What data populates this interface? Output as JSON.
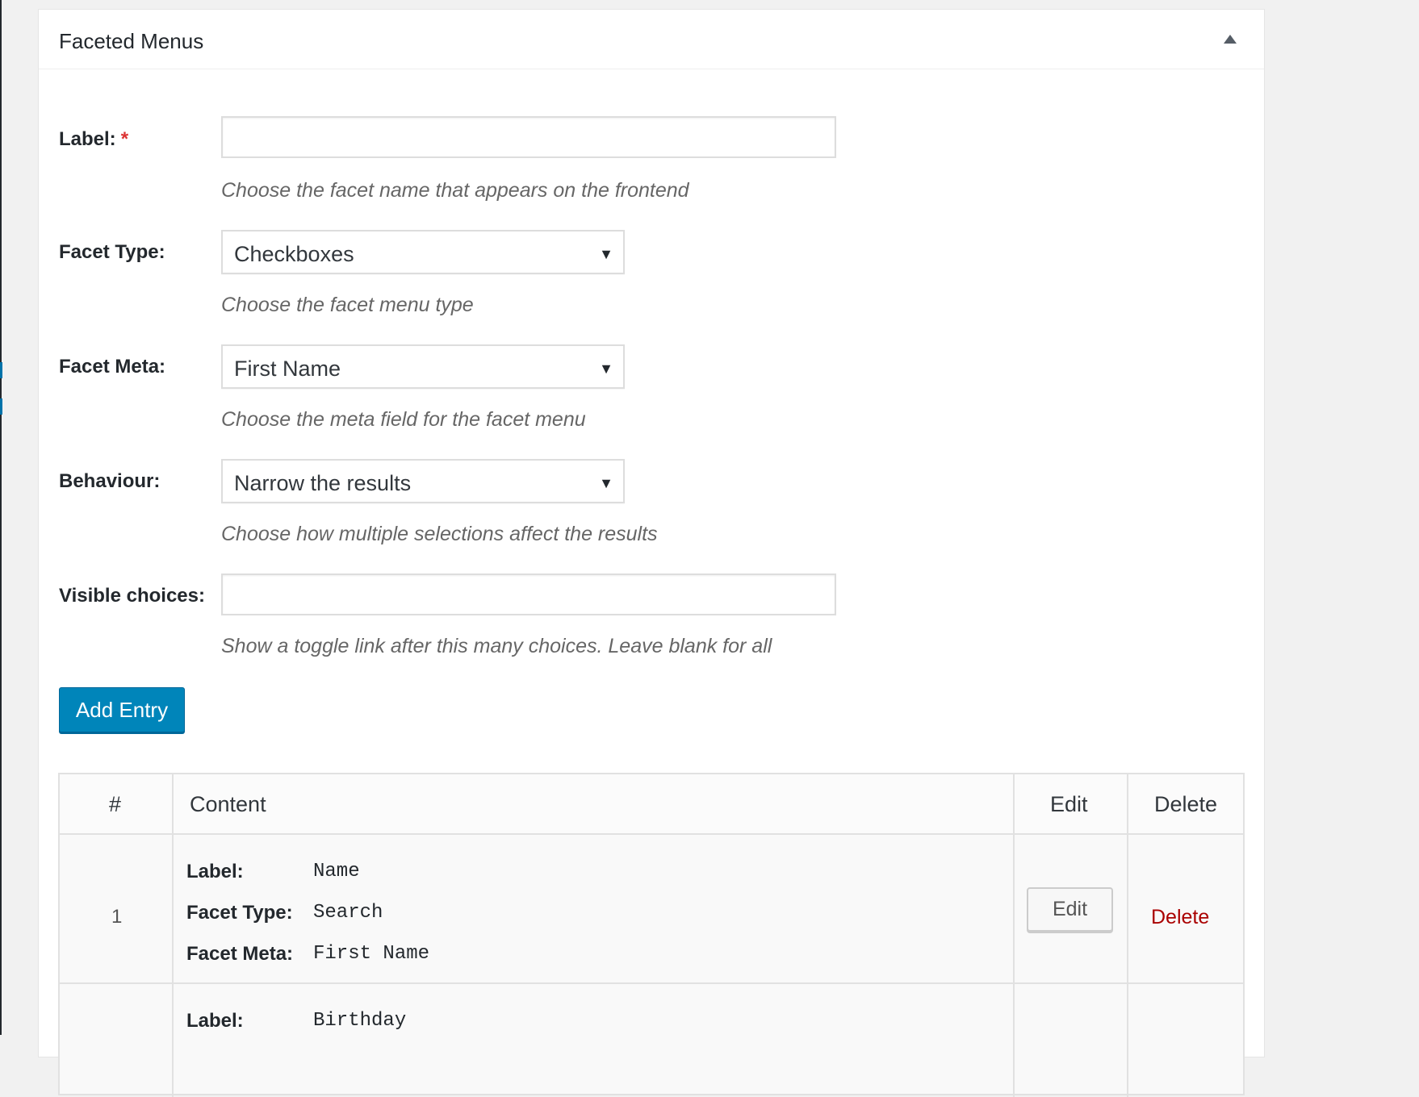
{
  "panel": {
    "title": "Faceted Menus"
  },
  "form": {
    "label": {
      "label": "Label:",
      "required": "*",
      "value": "",
      "description": "Choose the facet name that appears on the frontend"
    },
    "facet_type": {
      "label": "Facet Type:",
      "value": "Checkboxes",
      "description": "Choose the facet menu type"
    },
    "facet_meta": {
      "label": "Facet Meta:",
      "value": "First Name",
      "description": "Choose the meta field for the facet menu"
    },
    "behaviour": {
      "label": "Behaviour:",
      "value": "Narrow the results",
      "description": "Choose how multiple selections affect the results"
    },
    "visible_choices": {
      "label": "Visible choices:",
      "value": "",
      "description": "Show a toggle link after this many choices. Leave blank for all"
    },
    "add_button": "Add Entry"
  },
  "table": {
    "headers": {
      "num": "#",
      "content": "Content",
      "edit": "Edit",
      "delete": "Delete"
    },
    "rows": [
      {
        "num": "1",
        "fields": [
          {
            "label": "Label:",
            "value": "Name"
          },
          {
            "label": "Facet Type:",
            "value": "Search"
          },
          {
            "label": "Facet Meta:",
            "value": "First Name"
          }
        ],
        "edit_label": "Edit",
        "delete_label": "Delete"
      },
      {
        "fields": [
          {
            "label": "Label:",
            "value": "Birthday"
          }
        ]
      }
    ]
  },
  "icons": {
    "collapse": "triangle-up-icon",
    "select_arrow": "caret-down-icon"
  },
  "colors": {
    "primary_button": "#0085ba",
    "delete_link": "#aa0000",
    "required": "#dc3232"
  }
}
